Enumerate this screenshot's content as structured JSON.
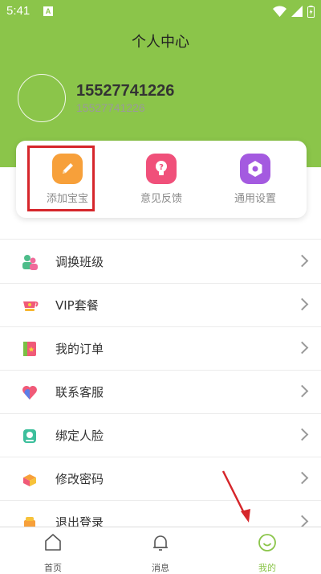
{
  "status_bar": {
    "time": "5:41",
    "notification_badge": "A"
  },
  "header": {
    "title": "个人中心"
  },
  "profile": {
    "name": "15527741226",
    "account": "15527741226"
  },
  "quick_actions": [
    {
      "label": "添加宝宝",
      "icon": "pencil-icon",
      "color": "#f7a03a"
    },
    {
      "label": "意见反馈",
      "icon": "lightbulb-question-icon",
      "color": "#f0507a"
    },
    {
      "label": "通用设置",
      "icon": "hexagon-settings-icon",
      "color": "#a45ae0"
    }
  ],
  "menu": [
    {
      "label": "调换班级",
      "icon": "people-swap-icon"
    },
    {
      "label": "VIP套餐",
      "icon": "vip-cup-icon"
    },
    {
      "label": "我的订单",
      "icon": "order-book-icon"
    },
    {
      "label": "联系客服",
      "icon": "heart-service-icon"
    },
    {
      "label": "绑定人脸",
      "icon": "face-bind-icon"
    },
    {
      "label": "修改密码",
      "icon": "password-box-icon"
    },
    {
      "label": "退出登录",
      "icon": "logout-icon"
    }
  ],
  "bottom_nav": [
    {
      "label": "首页",
      "icon": "home-icon",
      "active": false
    },
    {
      "label": "消息",
      "icon": "bell-icon",
      "active": false
    },
    {
      "label": "我的",
      "icon": "smile-icon",
      "active": true
    }
  ],
  "colors": {
    "primary_green": "#8bc54a",
    "highlight_red": "#d6262b"
  }
}
